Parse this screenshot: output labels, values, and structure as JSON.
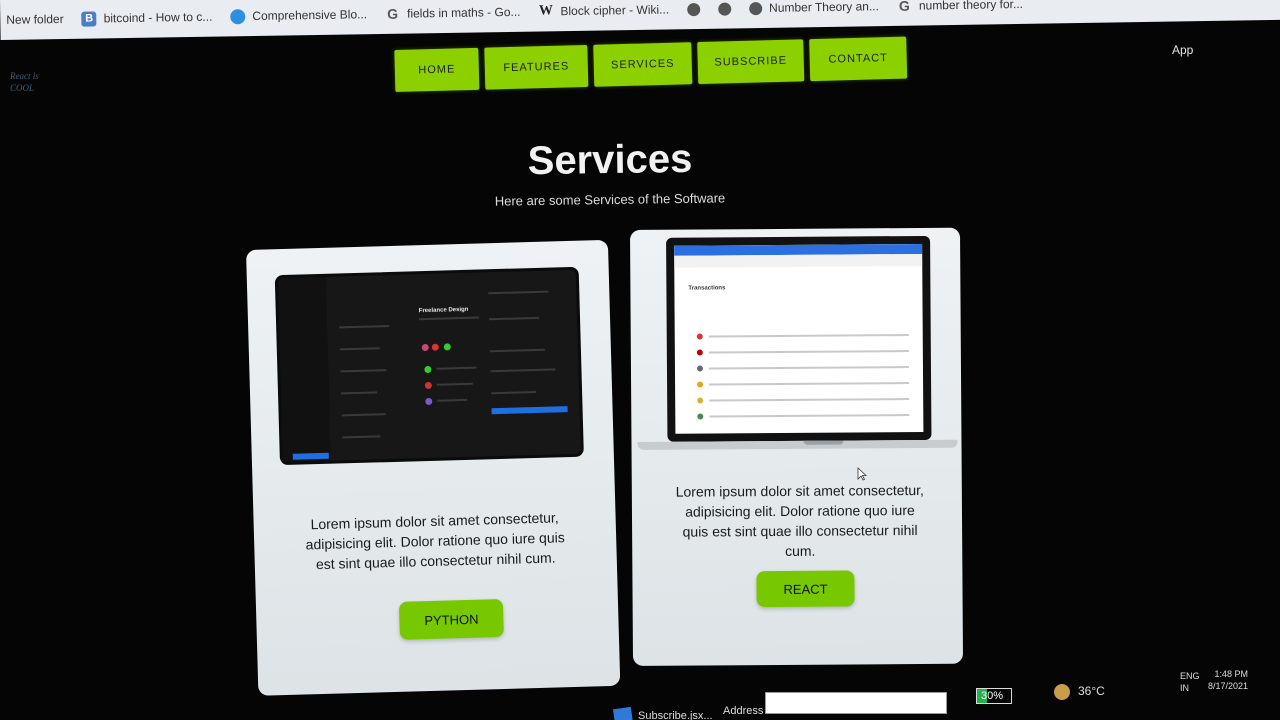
{
  "bookmarks": [
    {
      "label": "New folder",
      "icon": "folder-icon"
    },
    {
      "label": "bitcoind - How to c...",
      "icon": "bitcoin-stackexchange-icon"
    },
    {
      "label": "Comprehensive Blo...",
      "icon": "blue-circle-icon"
    },
    {
      "label": "fields in maths - Go...",
      "icon": "google-icon"
    },
    {
      "label": "Block cipher - Wiki...",
      "icon": "wikipedia-icon"
    },
    {
      "label": "",
      "icon": "globe-icon"
    },
    {
      "label": "",
      "icon": "globe-icon"
    },
    {
      "label": "Number Theory an...",
      "icon": "globe-icon"
    },
    {
      "label": "number theory for...",
      "icon": "google-icon"
    }
  ],
  "logo": {
    "line1": "React is",
    "line2": "COOL"
  },
  "nav": {
    "items": [
      "HOME",
      "FEATURES",
      "SERVICES",
      "SUBSCRIBE",
      "CONTACT"
    ],
    "app_label": "App"
  },
  "services": {
    "title": "Services",
    "subtitle": "Here are some Services of the Software"
  },
  "cards": [
    {
      "text": "Lorem ipsum dolor sit amet consectetur, adipisicing elit. Dolor ratione quo iure quis est sint quae illo consectetur nihil cum.",
      "button": "PYTHON",
      "mockup_title": "Freelance Design"
    },
    {
      "text": "Lorem ipsum dolor sit amet consectetur, adipisicing elit. Dolor ratione quo iure quis est sint quae illo consectetur nihil cum.",
      "button": "REACT",
      "mockup_title": "Transactions"
    }
  ],
  "taskbar": {
    "app_label": "Subscribe.jsx...",
    "address_label": "Address",
    "battery": "30%",
    "battery_level": 0.3,
    "temperature": "36°C",
    "lang_line1": "ENG",
    "lang_line2": "IN",
    "time": "1:48 PM",
    "date": "8/17/2021"
  },
  "colors": {
    "accent": "#8cd000",
    "background": "#050505",
    "card": "#e6ebee"
  }
}
